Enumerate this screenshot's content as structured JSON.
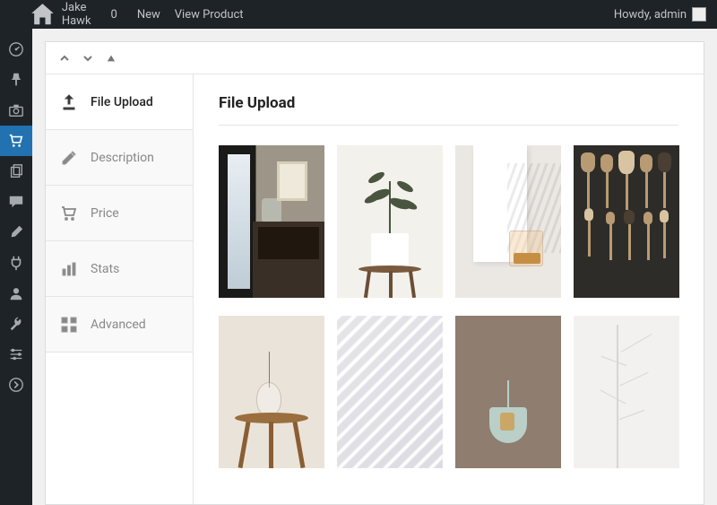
{
  "admin_bar": {
    "site_name": "Jake Hawk",
    "comments_count": "0",
    "new_label": "New",
    "view_label": "View Product",
    "howdy_label": "Howdy, admin"
  },
  "side_tabs": [
    {
      "id": "file-upload",
      "label": "File Upload",
      "active": true
    },
    {
      "id": "description",
      "label": "Description",
      "active": false
    },
    {
      "id": "price",
      "label": "Price",
      "active": false
    },
    {
      "id": "stats",
      "label": "Stats",
      "active": false
    },
    {
      "id": "advanced",
      "label": "Advanced",
      "active": false
    }
  ],
  "section_title": "File Upload"
}
